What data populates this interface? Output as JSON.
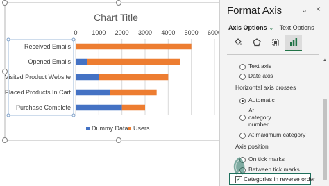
{
  "chart": {
    "title": "Chart Title",
    "colors": {
      "dummy": "#4472c4",
      "users": "#ed7d31"
    },
    "legend_position": "bottom"
  },
  "chart_data": {
    "type": "bar",
    "orientation": "horizontal",
    "stacked": true,
    "title": "Chart Title",
    "categories": [
      "Received Emails",
      "Opened Emails",
      "Visited Product Website",
      "Placed Products In Cart",
      "Purchase Complete"
    ],
    "series": [
      {
        "name": "Dummy Data",
        "values": [
          0,
          500,
          1000,
          1500,
          2000
        ]
      },
      {
        "name": "Users",
        "values": [
          5000,
          4000,
          3000,
          2000,
          1000
        ]
      }
    ],
    "xlim": [
      0,
      6000
    ],
    "ticks": [
      "0",
      "1000",
      "2000",
      "3000",
      "4000",
      "5000",
      "6000"
    ],
    "x_axis_position": "top",
    "grid": true
  },
  "pane": {
    "title": "Format Axis",
    "dropdown_icon": "chevron-down-icon",
    "close_label": "×",
    "tab_axis_options": "Axis Options",
    "tab_text_options": "Text Options",
    "options": {
      "text_axis": "Text axis",
      "date_axis": "Date axis",
      "horizontal_axis_crosses": "Horizontal axis crosses",
      "automatic": "Automatic",
      "at_category": "At category number",
      "at_maximum": "At maximum category",
      "axis_position": "Axis position",
      "on_tick_marks": "On tick marks",
      "between_tick_marks": "Between tick marks",
      "reverse_order": "Categories in reverse order"
    }
  }
}
